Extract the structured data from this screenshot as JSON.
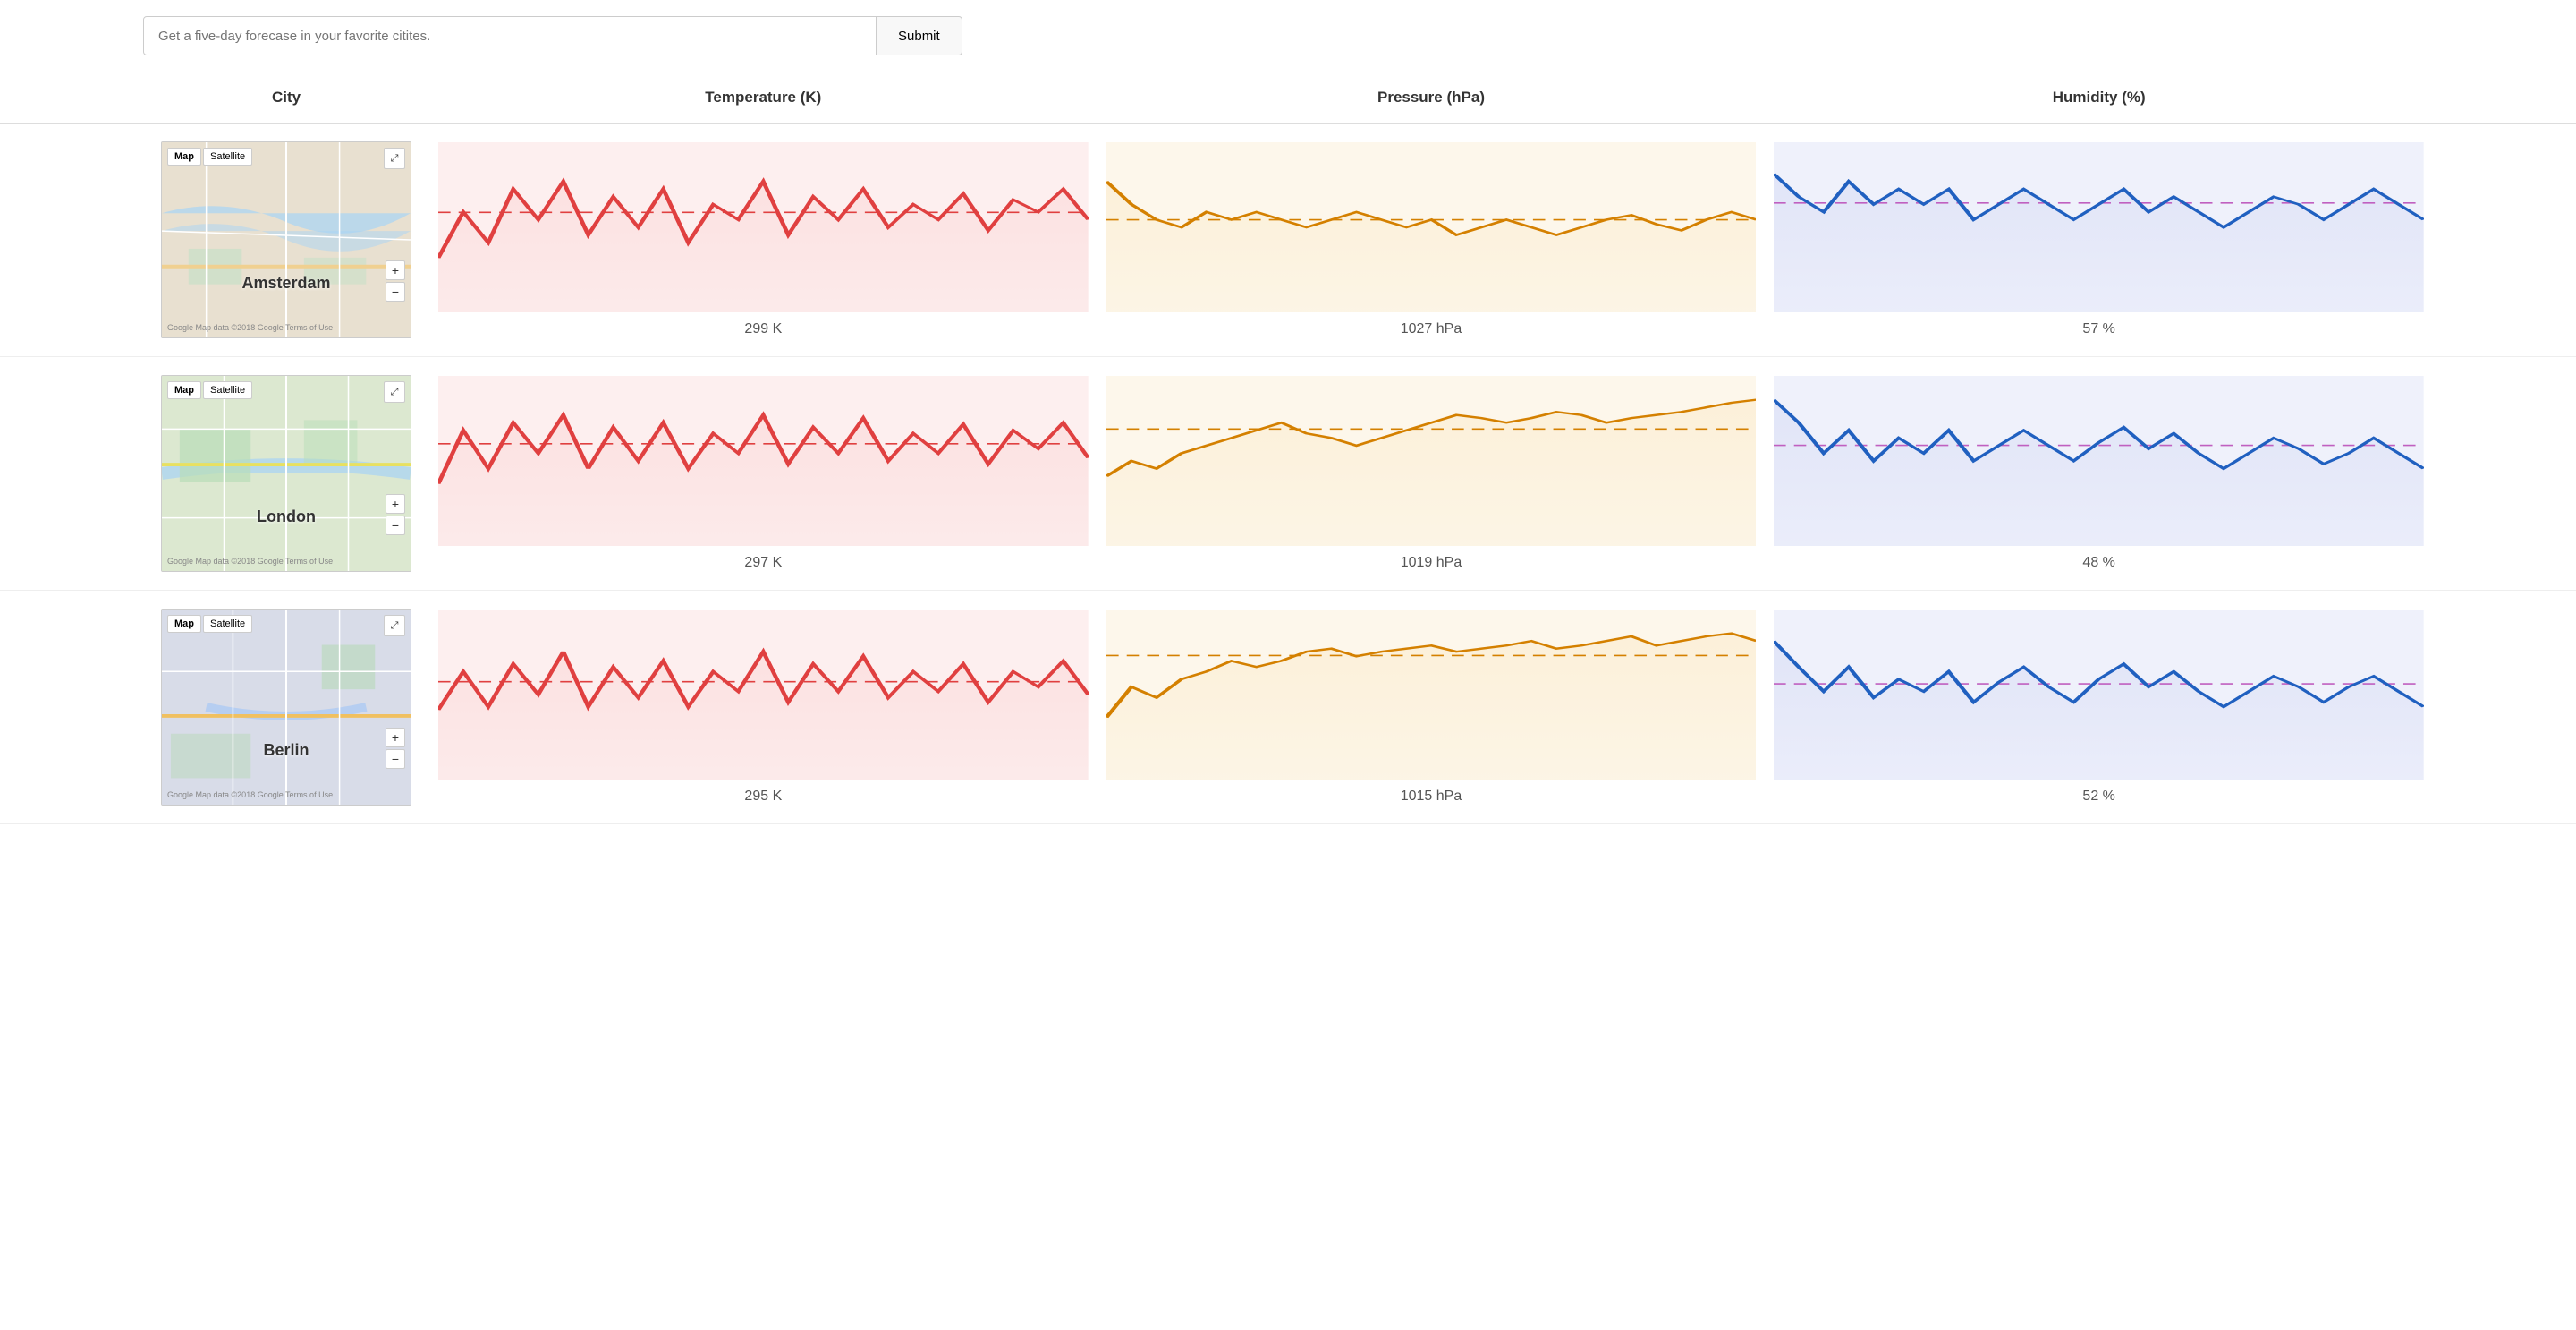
{
  "search": {
    "placeholder": "Get a five-day forecase in your favorite citites.",
    "submit_label": "Submit"
  },
  "columns": {
    "city": "City",
    "temperature": "Temperature (K)",
    "pressure": "Pressure (hPa)",
    "humidity": "Humidity (%)"
  },
  "cities": [
    {
      "name": "Amsterdam",
      "temperature_value": "299 K",
      "pressure_value": "1027 hPa",
      "humidity_value": "57 %",
      "map_type": "amsterdam",
      "temp_data": [
        30,
        60,
        40,
        75,
        55,
        80,
        45,
        70,
        50,
        75,
        40,
        65,
        55,
        80,
        45,
        70,
        55,
        75,
        50,
        65,
        55,
        72,
        48,
        68,
        60,
        75,
        55
      ],
      "pressure_data": [
        80,
        65,
        55,
        50,
        60,
        55,
        60,
        55,
        50,
        55,
        60,
        55,
        50,
        55,
        45,
        50,
        55,
        50,
        45,
        50,
        55,
        58,
        52,
        48,
        55,
        60,
        55
      ],
      "humidity_data": [
        85,
        70,
        60,
        80,
        65,
        75,
        65,
        75,
        55,
        65,
        75,
        65,
        55,
        65,
        75,
        60,
        70,
        60,
        50,
        60,
        70,
        65,
        55,
        65,
        75,
        65,
        55
      ]
    },
    {
      "name": "London",
      "temperature_value": "297 K",
      "pressure_value": "1019 hPa",
      "humidity_value": "48 %",
      "map_type": "london",
      "temp_data": [
        35,
        70,
        45,
        75,
        55,
        80,
        45,
        72,
        50,
        75,
        45,
        68,
        55,
        80,
        48,
        72,
        55,
        78,
        50,
        68,
        55,
        74,
        48,
        70,
        58,
        75,
        52
      ],
      "pressure_data": [
        40,
        50,
        45,
        55,
        60,
        65,
        70,
        75,
        68,
        65,
        60,
        65,
        70,
        75,
        80,
        78,
        75,
        78,
        82,
        80,
        75,
        78,
        80,
        82,
        85,
        88,
        90
      ],
      "humidity_data": [
        90,
        75,
        55,
        70,
        50,
        65,
        55,
        70,
        50,
        60,
        70,
        60,
        50,
        62,
        72,
        58,
        68,
        55,
        45,
        55,
        65,
        58,
        48,
        55,
        65,
        55,
        45
      ]
    },
    {
      "name": "Berlin",
      "temperature_value": "295 K",
      "pressure_value": "1015 hPa",
      "humidity_value": "52 %",
      "map_type": "berlin",
      "temp_data": [
        40,
        65,
        42,
        70,
        50,
        78,
        42,
        68,
        48,
        72,
        42,
        65,
        52,
        78,
        45,
        70,
        52,
        75,
        48,
        65,
        52,
        70,
        45,
        65,
        55,
        72,
        50
      ],
      "pressure_data": [
        35,
        55,
        48,
        60,
        65,
        72,
        68,
        72,
        78,
        80,
        75,
        78,
        80,
        82,
        78,
        80,
        82,
        85,
        80,
        82,
        85,
        88,
        82,
        85,
        88,
        90,
        85
      ],
      "humidity_data": [
        85,
        68,
        52,
        68,
        48,
        60,
        52,
        65,
        45,
        58,
        68,
        55,
        45,
        60,
        70,
        55,
        65,
        52,
        42,
        52,
        62,
        55,
        45,
        55,
        62,
        52,
        42
      ]
    }
  ]
}
